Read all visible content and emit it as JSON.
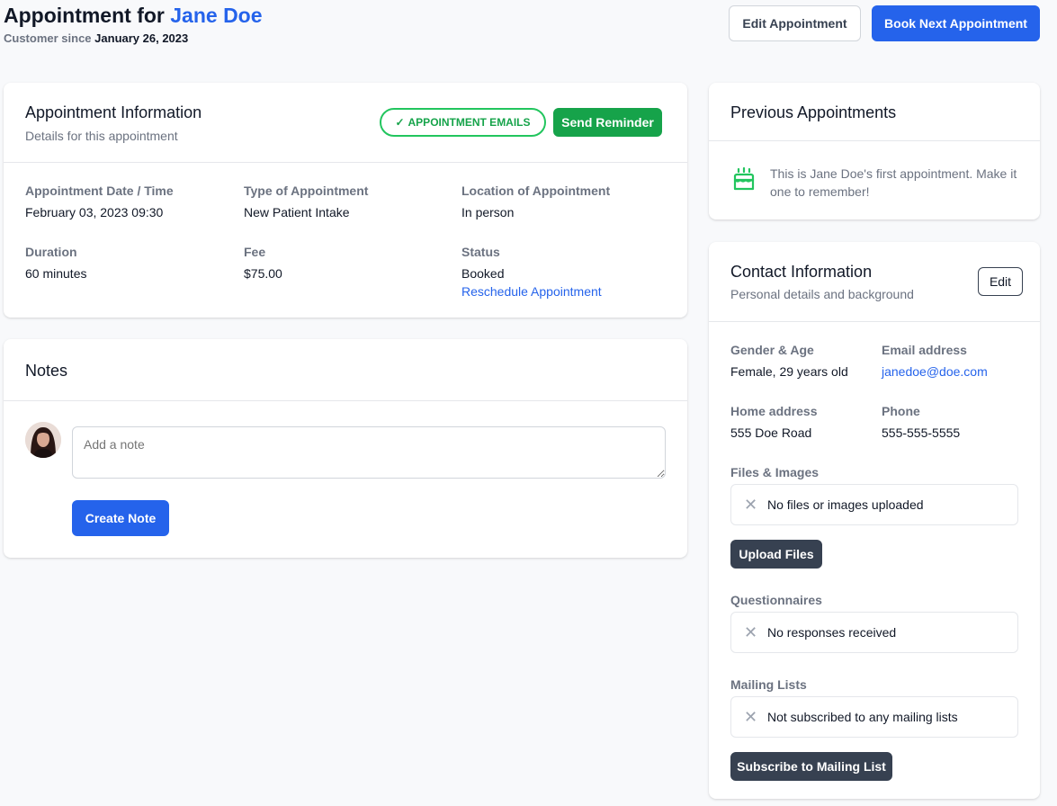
{
  "header": {
    "title_prefix": "Appointment for",
    "customer_name": "Jane Doe",
    "since_label": "Customer since",
    "since_date": "January 26, 2023",
    "edit_button": "Edit Appointment",
    "book_button": "Book Next Appointment"
  },
  "appointment": {
    "title": "Appointment Information",
    "subtitle": "Details for this appointment",
    "emails_badge": "APPOINTMENT EMAILS",
    "reminder_button": "Send Reminder",
    "fields": {
      "date_label": "Appointment Date / Time",
      "date_value": "February 03, 2023 09:30",
      "type_label": "Type of Appointment",
      "type_value": "New Patient Intake",
      "location_label": "Location of Appointment",
      "location_value": "In person",
      "duration_label": "Duration",
      "duration_value": "60 minutes",
      "fee_label": "Fee",
      "fee_value": "$75.00",
      "status_label": "Status",
      "status_value": "Booked",
      "reschedule_link": "Reschedule Appointment"
    }
  },
  "notes": {
    "title": "Notes",
    "placeholder": "Add a note",
    "create_button": "Create Note"
  },
  "previous": {
    "title": "Previous Appointments",
    "message": "This is Jane Doe's first appointment. Make it one to remember!",
    "icon": "cake-icon"
  },
  "contact": {
    "title": "Contact Information",
    "subtitle": "Personal details and background",
    "edit_button": "Edit",
    "gender_label": "Gender & Age",
    "gender_value": "Female, 29 years old",
    "email_label": "Email address",
    "email_value": "janedoe@doe.com",
    "address_label": "Home address",
    "address_value": "555 Doe Road",
    "phone_label": "Phone",
    "phone_value": "555-555-5555",
    "files_label": "Files & Images",
    "files_empty": "No files or images uploaded",
    "upload_button": "Upload Files",
    "questionnaires_label": "Questionnaires",
    "questionnaires_empty": "No responses received",
    "mailing_label": "Mailing Lists",
    "mailing_empty": "Not subscribed to any mailing lists",
    "subscribe_button": "Subscribe to Mailing List"
  },
  "colors": {
    "primary": "#2563eb",
    "success": "#16a34a",
    "success_light": "#22c55e",
    "dark_button": "#374151",
    "background": "#f8f9fb"
  }
}
